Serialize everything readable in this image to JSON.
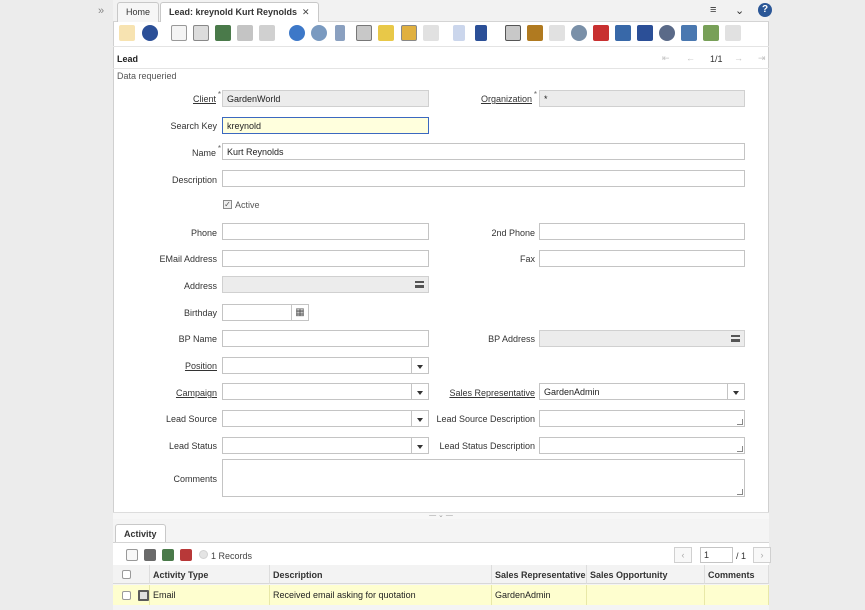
{
  "tabs": [
    {
      "label": "Home"
    },
    {
      "label": "Lead: kreynold Kurt Reynolds"
    }
  ],
  "window_title": "Lead",
  "record_position": "1/1",
  "status_message": "Data requeried",
  "form": {
    "client": {
      "label": "Client",
      "value": "GardenWorld"
    },
    "organization": {
      "label": "Organization",
      "value": "*"
    },
    "search_key": {
      "label": "Search Key",
      "value": "kreynold"
    },
    "name": {
      "label": "Name",
      "value": "Kurt Reynolds"
    },
    "description": {
      "label": "Description",
      "value": ""
    },
    "active": {
      "label": "Active",
      "checked": true
    },
    "phone": {
      "label": "Phone",
      "value": ""
    },
    "phone2": {
      "label": "2nd Phone",
      "value": ""
    },
    "email": {
      "label": "EMail Address",
      "value": ""
    },
    "fax": {
      "label": "Fax",
      "value": ""
    },
    "address": {
      "label": "Address",
      "value": ""
    },
    "birthday": {
      "label": "Birthday",
      "value": ""
    },
    "bp_name": {
      "label": "BP Name",
      "value": ""
    },
    "bp_address": {
      "label": "BP Address",
      "value": ""
    },
    "position": {
      "label": "Position",
      "value": ""
    },
    "campaign": {
      "label": "Campaign",
      "value": ""
    },
    "sales_rep": {
      "label": "Sales Representative",
      "value": "GardenAdmin"
    },
    "lead_source": {
      "label": "Lead Source",
      "value": ""
    },
    "lead_source_desc": {
      "label": "Lead Source Description",
      "value": ""
    },
    "lead_status": {
      "label": "Lead Status",
      "value": ""
    },
    "lead_status_desc": {
      "label": "Lead Status Description",
      "value": ""
    },
    "comments": {
      "label": "Comments",
      "value": ""
    }
  },
  "subtab": {
    "label": "Activity",
    "records_label": "1 Records",
    "page_input": "1",
    "page_total": "/ 1",
    "columns": [
      "Activity Type",
      "Description",
      "Sales Representative",
      "Sales Opportunity",
      "Comments"
    ],
    "rows": [
      {
        "activity_type": "Email",
        "description": "Received email asking for quotation",
        "sales_rep": "GardenAdmin",
        "sales_opportunity": "",
        "comments": ""
      }
    ]
  },
  "colors": {
    "focus_field_bg": "#ffffdd",
    "focus_border": "#3b68c0",
    "selected_row_bg": "#fefecf",
    "readonly_bg": "#ececec"
  },
  "icons": {
    "toolbar": [
      "undo-icon",
      "help-icon",
      "new-record-icon",
      "copy-record-icon",
      "delete-icon",
      "save-icon",
      "save-new-icon",
      "refresh-icon",
      "find-icon",
      "attachment-icon",
      "chat-icon",
      "note-icon",
      "grid-toggle-icon",
      "history-icon",
      "previous-icon",
      "next-icon",
      "report-icon",
      "archive-icon",
      "print-icon",
      "print-preview-icon",
      "zoom-across-icon",
      "request-icon",
      "product-info-icon",
      "workflow-icon",
      "process-icon",
      "export-icon",
      "import-icon",
      "lock-icon"
    ]
  }
}
